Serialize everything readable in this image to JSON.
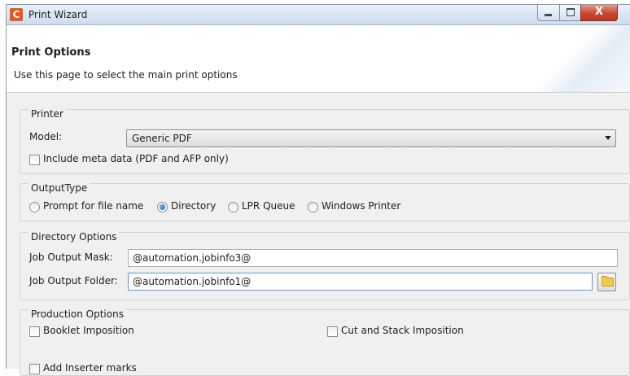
{
  "window": {
    "title": "Print Wizard",
    "app_icon_letter": "C",
    "controls": {
      "minimize": "",
      "maximize": "",
      "close": "X"
    }
  },
  "header": {
    "title": "Print Options",
    "description": "Use this page to select the main print options"
  },
  "printer": {
    "group_label": "Printer",
    "model_label": "Model:",
    "model_value": "Generic PDF",
    "include_meta_label": "Include meta data (PDF and AFP only)",
    "include_meta_checked": false
  },
  "output_type": {
    "group_label": "OutputType",
    "options": [
      {
        "label": "Prompt for file name",
        "selected": false
      },
      {
        "label": "Directory",
        "selected": true
      },
      {
        "label": "LPR Queue",
        "selected": false
      },
      {
        "label": "Windows Printer",
        "selected": false
      }
    ]
  },
  "directory": {
    "group_label": "Directory Options",
    "mask_label": "Job Output Mask:",
    "mask_value": "@automation.jobinfo3@",
    "folder_label": "Job Output Folder:",
    "folder_value": "@automation.jobinfo1@"
  },
  "production": {
    "group_label": "Production Options",
    "booklet_label": "Booklet Imposition",
    "cut_stack_label": "Cut and Stack Imposition",
    "inserter_label": "Add Inserter marks"
  }
}
